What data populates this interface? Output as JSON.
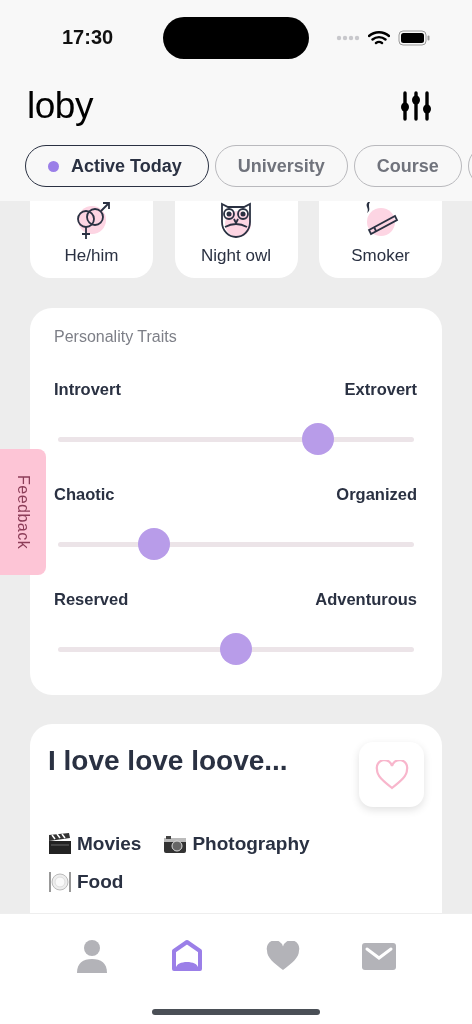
{
  "status_bar": {
    "time": "17:30"
  },
  "header": {
    "title": "loby"
  },
  "filter_chips": [
    {
      "label": "Active Today",
      "selected": true
    },
    {
      "label": "University",
      "selected": false
    },
    {
      "label": "Course",
      "selected": false
    },
    {
      "selected": false
    }
  ],
  "attributes": [
    {
      "kind": "gender",
      "label": "He/him"
    },
    {
      "kind": "owl",
      "label": "Night owl"
    },
    {
      "kind": "smoker",
      "label": "Smoker"
    }
  ],
  "personality": {
    "title": "Personality Traits",
    "traits": [
      {
        "left": "Introvert",
        "right": "Extrovert",
        "level": 0.73
      },
      {
        "left": "Chaotic",
        "right": "Organized",
        "level": 0.27
      },
      {
        "left": "Reserved",
        "right": "Adventurous",
        "level": 0.5
      }
    ]
  },
  "interests": {
    "title": "I love love loove...",
    "liked": false,
    "items": [
      {
        "kind": "movies",
        "label": "Movies"
      },
      {
        "kind": "photography",
        "label": "Photography"
      },
      {
        "kind": "food",
        "label": "Food"
      }
    ]
  },
  "feedback": {
    "label": "Feedback"
  },
  "tab_bar": [
    {
      "kind": "profile",
      "selected": false
    },
    {
      "kind": "home",
      "selected": true
    },
    {
      "kind": "likes",
      "selected": false
    },
    {
      "kind": "messages",
      "selected": false
    }
  ]
}
